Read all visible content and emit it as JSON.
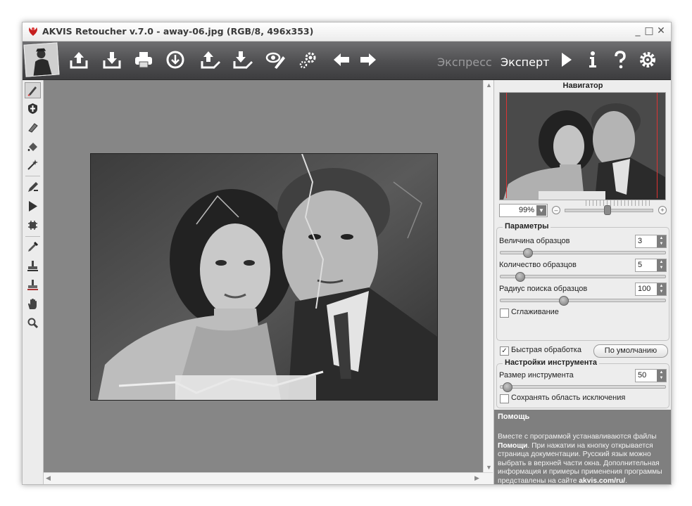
{
  "window": {
    "title": "AKVIS Retoucher v.7.0 - away-06.jpg (RGB/8, 496x353)",
    "controls": [
      "_",
      "□",
      "✕"
    ]
  },
  "toolbar": {
    "buttons": [
      "open-icon",
      "save-icon",
      "print-icon",
      "share-icon",
      "import-pattern-icon",
      "export-pattern-icon",
      "plugins-icon",
      "preferences-gear-icon",
      "undo-arrow-icon",
      "redo-arrow-icon"
    ],
    "modes": {
      "express": "Экспресс",
      "expert": "Эксперт"
    },
    "right_buttons": [
      "run-icon",
      "info-icon",
      "help-icon",
      "settings-icon"
    ]
  },
  "tools": [
    "selection-brush-icon",
    "exclusion-shield-icon",
    "eraser-icon",
    "bucket-icon",
    "magic-wand-icon",
    "pencil-icon",
    "run-triangle-icon",
    "chip-icon",
    "pipette-icon",
    "stamp-icon",
    "pattern-stamp-icon",
    "hand-icon",
    "zoom-icon"
  ],
  "navigator": {
    "title": "Навигатор",
    "zoom": "99%"
  },
  "params": {
    "title": "Параметры",
    "sample_size": {
      "label": "Величина образцов",
      "value": "3",
      "level": 0.15
    },
    "sample_count": {
      "label": "Количество образцов",
      "value": "5",
      "level": 0.1
    },
    "search_radius": {
      "label": "Радиус поиска образцов",
      "value": "100",
      "level": 0.38
    },
    "smoothing": {
      "label": "Сглаживание",
      "checked": false
    }
  },
  "fast_processing": {
    "label": "Быстрая обработка",
    "checked": true
  },
  "defaults_button": "По умолчанию",
  "tool_settings": {
    "title": "Настройки инструмента",
    "tool_size": {
      "label": "Размер инструмента",
      "value": "50",
      "level": 0.02
    },
    "keep_exclusion": {
      "label": "Сохранять область исключения",
      "checked": false
    }
  },
  "help": {
    "title": "Помощь",
    "p1": "Вместе с программой устанавливаются файлы ",
    "bold1": "Помощи",
    "p2": ". При нажатии на кнопку открывается страница документации. Русский язык можно выбрать в верхней части окна. Дополнительная информация и примеры применения программы представлены на сайте ",
    "bold2": "akvis.com/ru/",
    "p3": "."
  }
}
